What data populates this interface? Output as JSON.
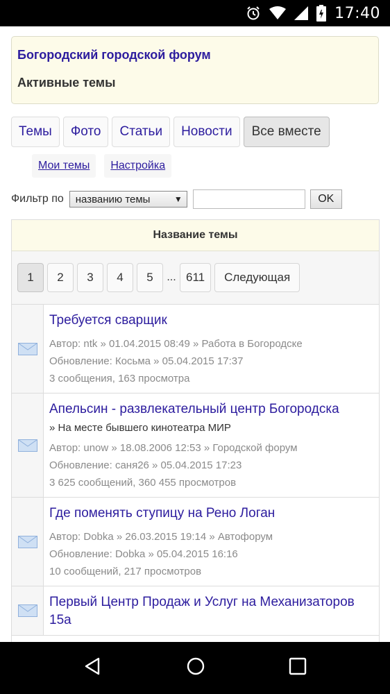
{
  "status_bar": {
    "time": "17:40"
  },
  "header": {
    "forum_title": "Богородский городской форум",
    "page_title": "Активные темы"
  },
  "tabs": [
    {
      "label": "Темы",
      "active": false
    },
    {
      "label": "Фото",
      "active": false
    },
    {
      "label": "Статьи",
      "active": false
    },
    {
      "label": "Новости",
      "active": false
    },
    {
      "label": "Все вместе",
      "active": true
    }
  ],
  "sublinks": [
    {
      "label": "Мои темы"
    },
    {
      "label": "Настройка"
    }
  ],
  "filter": {
    "label": "Фильтр по",
    "selected": "названию темы",
    "input_value": "",
    "button": "OK"
  },
  "table": {
    "header": "Название темы",
    "pager": {
      "pages": [
        "1",
        "2",
        "3",
        "4",
        "5"
      ],
      "ellipsis": "...",
      "last": "611",
      "next": "Следующая",
      "current": "1"
    },
    "topics": [
      {
        "title": "Требуется сварщик",
        "subtitle": "",
        "author": "Автор: ntk » 01.04.2015 08:49 » Работа в Богородске",
        "update": "Обновление: Косьма » 05.04.2015 17:37",
        "stats": "3 сообщения, 163 просмотра"
      },
      {
        "title": "Апельсин - развлекательный центр Богородска",
        "subtitle": "» На месте бывшего кинотеатра МИР",
        "author": "Автор: unow » 18.08.2006 12:53 » Городской форум",
        "update": "Обновление: саня26 » 05.04.2015 17:23",
        "stats": "3 625 сообщений, 360 455 просмотров"
      },
      {
        "title": "Где поменять ступицу на Рено Логан",
        "subtitle": "",
        "author": "Автор: Dobka » 26.03.2015 19:14 » Автофорум",
        "update": "Обновление: Dobka » 05.04.2015 16:16",
        "stats": "10 сообщений, 217 просмотров"
      },
      {
        "title": "Первый Центр Продаж и Услуг на Механизаторов 15а",
        "subtitle": "",
        "author": "",
        "update": "",
        "stats": ""
      }
    ]
  },
  "colors": {
    "link": "#2c1c9e",
    "header_bg": "#fdfbe9",
    "meta_text": "#8a8a8a"
  },
  "icons": {
    "topic": "envelope-icon",
    "status": [
      "alarm-icon",
      "wifi-icon",
      "signal-icon",
      "battery-icon"
    ],
    "nav": [
      "back-icon",
      "home-icon",
      "recents-icon"
    ]
  }
}
